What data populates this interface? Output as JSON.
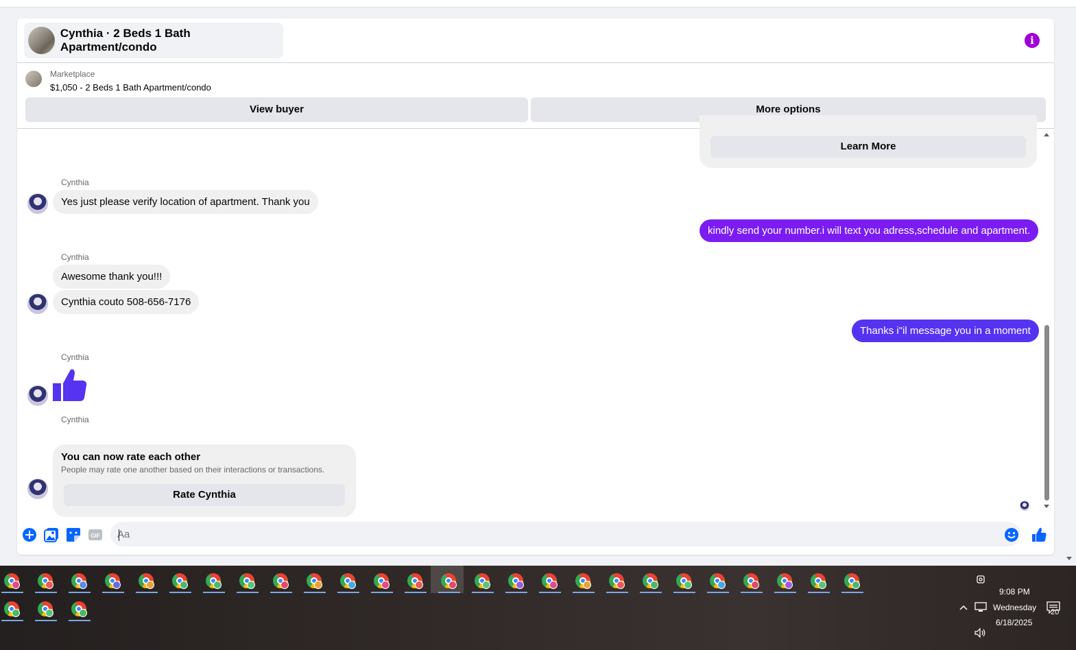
{
  "header": {
    "title": "Cynthia · 2 Beds 1 Bath Apartment/condo"
  },
  "listing": {
    "category": "Marketplace",
    "price_title": "$1,050 - 2 Beds 1 Bath Apartment/condo",
    "view_buyer_label": "View buyer",
    "more_options_label": "More options"
  },
  "messages": {
    "top_card_button": "Learn More",
    "m1_sender": "Cynthia",
    "m1_text": "Yes just please verify location of apartment. Thank you",
    "m2_text": "kindly send your number.i will text you adress,schedule and apartment.",
    "m3_sender": "Cynthia",
    "m3_text": "Awesome thank you!!!",
    "m4_text": "Cynthia couto 508-656-7176",
    "m5_text": "Thanks i\"il message you in a moment",
    "m6_sender": "Cynthia",
    "m7_sender": "Cynthia",
    "rate_title": "You can now rate each other",
    "rate_subtitle": "People may rate one another based on their interactions or transactions.",
    "rate_button": "Rate Cynthia"
  },
  "composer": {
    "placeholder": "Aa"
  },
  "colors": {
    "accent_purple": "#7b1cf2",
    "accent_blue_purple": "#5533f0",
    "brand_blue": "#0866ff",
    "info_purple": "#a100d6"
  },
  "taskbar": {
    "time": "9:08 PM",
    "day": "Wednesday",
    "date": "6/18/2025",
    "notifications": "20"
  }
}
